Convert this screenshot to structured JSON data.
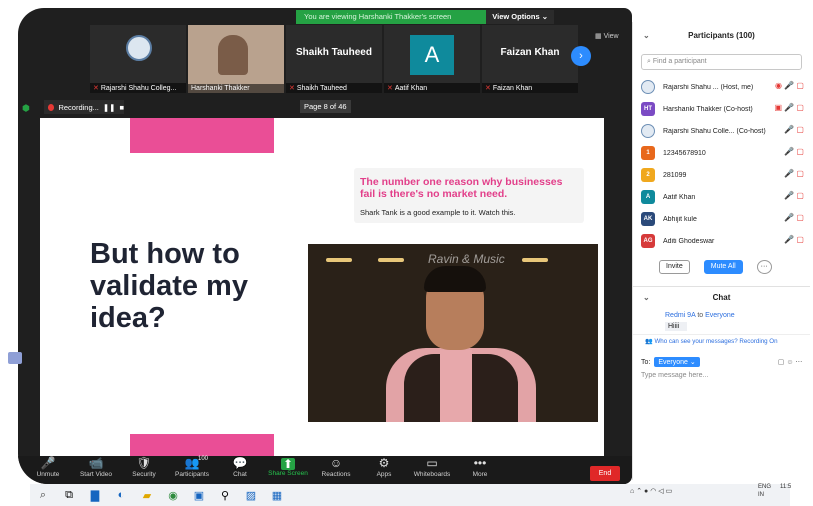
{
  "share_banner": {
    "message": "You are viewing Harshanki Thakker's screen",
    "view_options": "View Options ⌄"
  },
  "thumbnails": [
    {
      "name": "Rajarshi Shahu Colleg...",
      "type": "logo"
    },
    {
      "name": "Harshanki Thakker",
      "type": "camera"
    },
    {
      "name": "Shaikh Tauheed",
      "display": "Shaikh Tauheed",
      "type": "name"
    },
    {
      "name": "Aatif Khan",
      "letter": "A",
      "type": "avatar"
    },
    {
      "name": "Faizan Khan",
      "display": "Faizan Khan",
      "type": "name"
    }
  ],
  "view_label": "View",
  "recording": {
    "label": "Recording..."
  },
  "page_indicator": "Page 8 of 46",
  "slide": {
    "quote": "The number one reason why businesses fail is there's no market need.",
    "quote_sub": "Shark Tank is a good example to it. Watch this.",
    "headline": "But how to validate my idea?",
    "video_watermark": "Ravin & Music"
  },
  "toolbar": [
    {
      "key": "unmute",
      "icon": "mic-off-icon",
      "glyph": "🎤",
      "label": "Unmute"
    },
    {
      "key": "start-video",
      "icon": "video-off-icon",
      "glyph": "📹",
      "label": "Start Video"
    },
    {
      "key": "security",
      "icon": "shield-icon",
      "glyph": "🛡",
      "label": "Security"
    },
    {
      "key": "participants",
      "icon": "people-icon",
      "glyph": "👥",
      "label": "Participants",
      "count": "100"
    },
    {
      "key": "chat",
      "icon": "chat-icon",
      "glyph": "💬",
      "label": "Chat"
    },
    {
      "key": "share-screen",
      "icon": "share-screen-icon",
      "glyph": "⬆",
      "label": "Share Screen",
      "green": true
    },
    {
      "key": "reactions",
      "icon": "reactions-icon",
      "glyph": "☺",
      "label": "Reactions"
    },
    {
      "key": "apps",
      "icon": "apps-icon",
      "glyph": "⚙",
      "label": "Apps"
    },
    {
      "key": "whiteboards",
      "icon": "whiteboard-icon",
      "glyph": "▭",
      "label": "Whiteboards"
    },
    {
      "key": "more",
      "icon": "more-icon",
      "glyph": "•••",
      "label": "More"
    }
  ],
  "end_label": "End",
  "participants_panel": {
    "title": "Participants (100)",
    "search_placeholder": "Find a participant",
    "participants": [
      {
        "avatar": "",
        "color": "seal",
        "name": "Rajarshi Shahu ... (Host, me)",
        "icons": "◉ 🎤 ▢"
      },
      {
        "avatar": "HT",
        "color": "#7b4bc4",
        "name": "Harshanki Thakker (Co-host)",
        "icons": "▣ 🎤 ▢"
      },
      {
        "avatar": "",
        "color": "seal",
        "name": "Rajarshi Shahu Colle... (Co-host)",
        "icons": "🎤 ▢"
      },
      {
        "avatar": "1",
        "color": "#e8681c",
        "name": "12345678910",
        "icons": "🎤 ▢"
      },
      {
        "avatar": "2",
        "color": "#f0a81e",
        "name": "281099",
        "icons": "🎤 ▢"
      },
      {
        "avatar": "A",
        "color": "#0f8a9c",
        "name": "Aatif Khan",
        "icons": "🎤 ▢"
      },
      {
        "avatar": "AK",
        "color": "#2b4a7a",
        "name": "Abhijit kule",
        "icons": "🎤 ▢"
      },
      {
        "avatar": "AG",
        "color": "#d63a3a",
        "name": "Aditi Ghodeswar",
        "icons": "🎤 ▢"
      }
    ],
    "invite_label": "Invite",
    "mute_all_label": "Mute All",
    "more_label": "···"
  },
  "chat_panel": {
    "title": "Chat",
    "from": "Redmi 9A",
    "to_word": "to",
    "to_target": "Everyone",
    "message": "Hiiii",
    "notice": "Who can see your messages? Recording On",
    "to_label": "To:",
    "to_select": "Everyone ⌄",
    "input_placeholder": "Type message here..."
  },
  "taskbar": {
    "lang": "ENG",
    "lang2": "IN",
    "time": "11:5"
  }
}
